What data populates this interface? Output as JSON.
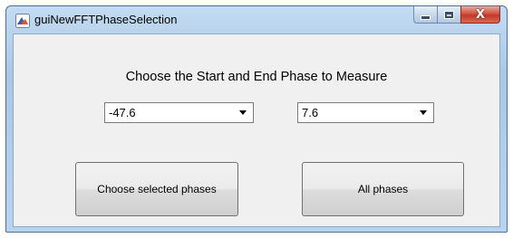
{
  "window": {
    "title": "guiNewFFTPhaseSelection",
    "close_glyph": "X"
  },
  "main": {
    "prompt": "Choose the Start and End Phase to Measure",
    "start_phase": {
      "value": "-47.6"
    },
    "end_phase": {
      "value": "7.6"
    },
    "choose_selected_label": "Choose selected phases",
    "all_phases_label": "All phases"
  },
  "icons": {
    "app": "matlab-icon",
    "minimize": "minimize-icon",
    "maximize": "maximize-icon",
    "close": "close-icon",
    "dropdown": "chevron-down-icon"
  },
  "colors": {
    "close_button": "#c1392a",
    "title_bar": "#b8d3ee",
    "client_bg": "#f0f0f0"
  }
}
